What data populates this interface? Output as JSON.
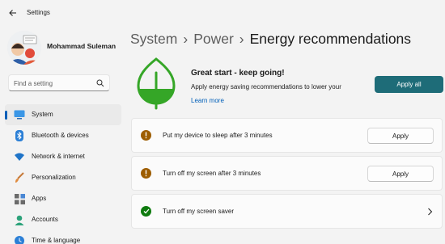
{
  "app": {
    "title": "Settings"
  },
  "user": {
    "name": "Mohammad Suleman"
  },
  "search": {
    "placeholder": "Find a setting"
  },
  "sidebar": {
    "items": [
      {
        "label": "System",
        "icon": "monitor-icon",
        "active": true
      },
      {
        "label": "Bluetooth & devices",
        "icon": "bluetooth-icon"
      },
      {
        "label": "Network & internet",
        "icon": "wifi-icon"
      },
      {
        "label": "Personalization",
        "icon": "brush-icon"
      },
      {
        "label": "Apps",
        "icon": "apps-icon"
      },
      {
        "label": "Accounts",
        "icon": "person-icon"
      },
      {
        "label": "Time & language",
        "icon": "clock-globe-icon"
      }
    ]
  },
  "breadcrumb": {
    "part1": "System",
    "part2": "Power",
    "current": "Energy recommendations",
    "separator": "›"
  },
  "hero": {
    "title": "Great start - keep going!",
    "description": "Apply energy saving recommendations to lower your",
    "link": "Learn more",
    "apply_all": "Apply all"
  },
  "recommendations": [
    {
      "label": "Put my device to sleep after 3 minutes",
      "status": "warning",
      "action": "Apply"
    },
    {
      "label": "Turn off my screen after 3 minutes",
      "status": "warning",
      "action": "Apply"
    },
    {
      "label": "Turn off my screen saver",
      "status": "done"
    }
  ],
  "colors": {
    "accent": "#005fb8",
    "apply_all_bg": "#1e6c78",
    "warning": "#9d5d00",
    "success": "#0f7b0f",
    "leaf": "#35a627"
  }
}
